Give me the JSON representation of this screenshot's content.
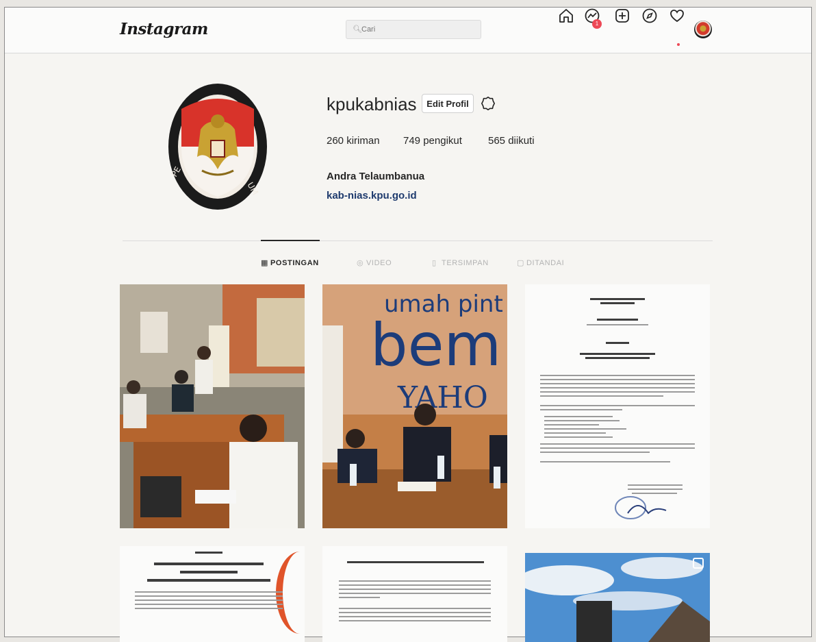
{
  "header": {
    "logo": "Instagram",
    "search": {
      "icon": "search-icon",
      "placeholder": "Cari"
    },
    "nav_icons": [
      "home-icon",
      "messenger-icon",
      "new-post-icon",
      "explore-icon",
      "activity-heart-icon",
      "profile-avatar"
    ],
    "message_badge": "1"
  },
  "profile": {
    "username": "kpukabnias",
    "edit_button": "Edit Profil",
    "settings_icon": "gear-icon",
    "stats": [
      {
        "count": "260",
        "label": "kiriman"
      },
      {
        "count": "749",
        "label": "pengikut"
      },
      {
        "count": "565",
        "label": "diikuti"
      }
    ],
    "full_name": "Andra Telaumbanua",
    "website": "kab-nias.kpu.go.id"
  },
  "tabs": [
    {
      "label": "POSTINGAN",
      "icon": "grid-icon",
      "active": true
    },
    {
      "label": "VIDEO",
      "icon": "video-icon",
      "active": false
    },
    {
      "label": "TERSIMPAN",
      "icon": "bookmark-icon",
      "active": false
    },
    {
      "label": "DITANDAI",
      "icon": "tagged-icon",
      "active": false
    }
  ],
  "posts": [
    {
      "kind": "photo",
      "subject": "meeting room with attendees"
    },
    {
      "kind": "photo",
      "subject": "speakers in front of banner"
    },
    {
      "kind": "document",
      "subject": "official announcement letter"
    },
    {
      "kind": "document",
      "subject": "coordination meeting notice"
    },
    {
      "kind": "document",
      "subject": "recruitment announcement"
    },
    {
      "kind": "photo",
      "subject": "building under sky"
    }
  ],
  "colors": {
    "accent": "#ed4956",
    "link": "#1f3b6e",
    "text": "#262626",
    "muted": "#8e8e8e"
  }
}
